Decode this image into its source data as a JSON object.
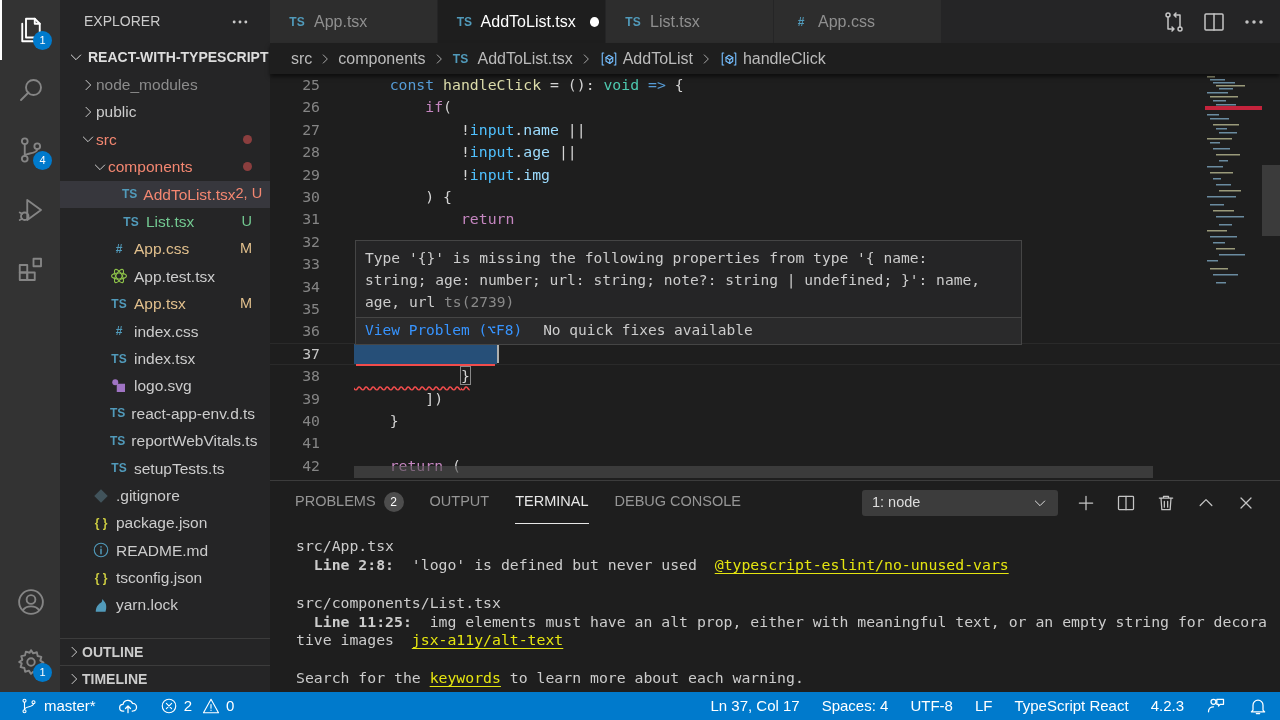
{
  "activity_bar": [
    {
      "kind": "files",
      "selected": true,
      "badge": "1"
    },
    {
      "kind": "search",
      "selected": false
    },
    {
      "kind": "source-control",
      "selected": false,
      "badge": "4"
    },
    {
      "kind": "run",
      "selected": false
    },
    {
      "kind": "extensions",
      "selected": false
    },
    {
      "kind": "account",
      "selected": false
    },
    {
      "kind": "settings",
      "selected": false,
      "badge": "1"
    }
  ],
  "sidebar": {
    "title": "EXPLORER",
    "root": {
      "label": "REACT-WITH-TYPESCRIPT",
      "expanded": true
    },
    "items": [
      {
        "name": "node_modules",
        "kind": "folder",
        "expanded": false,
        "color": "#8c8c8c"
      },
      {
        "name": "public",
        "kind": "folder",
        "expanded": false,
        "color": "#cccccc"
      },
      {
        "name": "src",
        "kind": "folder",
        "expanded": true,
        "color": "#f48771",
        "dot": true,
        "children": [
          {
            "name": "components",
            "kind": "folder",
            "expanded": true,
            "color": "#f48771",
            "dot": true,
            "children": [
              {
                "name": "AddToList.tsx",
                "kind": "ts-file",
                "glyph": "TS",
                "color": "#f48771",
                "badge": "2, U",
                "selected": true
              },
              {
                "name": "List.tsx",
                "kind": "ts-file",
                "glyph": "TS",
                "color": "#73c991",
                "badge": "U",
                "selected": false
              }
            ]
          },
          {
            "name": "App.css",
            "kind": "css-file",
            "glyph": "#",
            "color": "#e2c08d",
            "badge": "M",
            "selected": false
          },
          {
            "name": "App.test.tsx",
            "kind": "react-file",
            "color": "#cccccc",
            "selected": false
          },
          {
            "name": "App.tsx",
            "kind": "ts-file",
            "glyph": "TS",
            "color": "#e2c08d",
            "badge": "M",
            "selected": false
          },
          {
            "name": "index.css",
            "kind": "css-file",
            "glyph": "#",
            "color": "#cccccc",
            "selected": false
          },
          {
            "name": "index.tsx",
            "kind": "ts-file",
            "glyph": "TS",
            "color": "#cccccc",
            "selected": false
          },
          {
            "name": "logo.svg",
            "kind": "svg-file",
            "color": "#cccccc",
            "selected": false
          },
          {
            "name": "react-app-env.d.ts",
            "kind": "ts-file",
            "glyph": "TS",
            "color": "#cccccc",
            "selected": false
          },
          {
            "name": "reportWebVitals.ts",
            "kind": "ts-file",
            "glyph": "TS",
            "color": "#cccccc",
            "selected": false
          },
          {
            "name": "setupTests.ts",
            "kind": "ts-file",
            "glyph": "TS",
            "color": "#cccccc",
            "selected": false
          }
        ]
      },
      {
        "name": ".gitignore",
        "kind": "git-file",
        "color": "#cccccc",
        "selected": false
      },
      {
        "name": "package.json",
        "kind": "json-file",
        "glyph": "{ }",
        "color": "#cccccc",
        "selected": false
      },
      {
        "name": "README.md",
        "kind": "info-file",
        "color": "#cccccc",
        "selected": false
      },
      {
        "name": "tsconfig.json",
        "kind": "json-file",
        "glyph": "{ }",
        "color": "#cccccc",
        "selected": false
      },
      {
        "name": "yarn.lock",
        "kind": "yarn-file",
        "color": "#cccccc",
        "selected": false
      }
    ],
    "sections": [
      {
        "label": "OUTLINE",
        "expanded": false
      },
      {
        "label": "TIMELINE",
        "expanded": false
      }
    ]
  },
  "tabs": [
    {
      "label": "App.tsx",
      "glyph": "TS",
      "selected": false,
      "dirty": false
    },
    {
      "label": "AddToList.tsx",
      "glyph": "TS",
      "selected": true,
      "dirty": true
    },
    {
      "label": "List.tsx",
      "glyph": "TS",
      "selected": false,
      "dirty": false
    },
    {
      "label": "App.css",
      "glyph": "#",
      "selected": false,
      "dirty": false
    }
  ],
  "breadcrumbs": [
    {
      "label": "src",
      "kind": "folder"
    },
    {
      "label": "components",
      "kind": "folder"
    },
    {
      "label": "AddToList.tsx",
      "kind": "file",
      "glyph": "TS"
    },
    {
      "label": "AddToList",
      "kind": "symbol"
    },
    {
      "label": "handleClick",
      "kind": "symbol"
    }
  ],
  "code_lines": [
    {
      "number": "25",
      "tokens": [
        {
          "kind": "keyword",
          "text": "    const "
        },
        {
          "kind": "fn",
          "text": "handleClick"
        },
        {
          "kind": "plain",
          "text": " = (): "
        },
        {
          "kind": "type",
          "text": "void"
        },
        {
          "kind": "keyword",
          "text": " =>"
        },
        {
          "kind": "plain",
          "text": " {"
        }
      ]
    },
    {
      "number": "26",
      "tokens": [
        {
          "kind": "control",
          "text": "        if"
        },
        {
          "kind": "plain",
          "text": "("
        }
      ]
    },
    {
      "number": "27",
      "tokens": [
        {
          "kind": "plain",
          "text": "            !"
        },
        {
          "kind": "var",
          "text": "input"
        },
        {
          "kind": "plain",
          "text": "."
        },
        {
          "kind": "prop",
          "text": "name"
        },
        {
          "kind": "plain",
          "text": " ||"
        }
      ]
    },
    {
      "number": "28",
      "tokens": [
        {
          "kind": "plain",
          "text": "            !"
        },
        {
          "kind": "var",
          "text": "input"
        },
        {
          "kind": "plain",
          "text": "."
        },
        {
          "kind": "prop",
          "text": "age"
        },
        {
          "kind": "plain",
          "text": " ||"
        }
      ]
    },
    {
      "number": "29",
      "tokens": [
        {
          "kind": "plain",
          "text": "            !"
        },
        {
          "kind": "var",
          "text": "input"
        },
        {
          "kind": "plain",
          "text": "."
        },
        {
          "kind": "prop",
          "text": "img"
        }
      ]
    },
    {
      "number": "30",
      "tokens": [
        {
          "kind": "plain",
          "text": "        ) {"
        }
      ]
    },
    {
      "number": "31",
      "tokens": [
        {
          "kind": "control",
          "text": "            return"
        }
      ]
    },
    {
      "number": "32"
    },
    {
      "number": "33"
    },
    {
      "number": "34"
    },
    {
      "number": "35"
    },
    {
      "number": "36"
    },
    {
      "number": "37",
      "current": true,
      "error": true
    },
    {
      "number": "38",
      "current": false,
      "error": true,
      "tokens": [
        {
          "kind": "bracket",
          "text": "            }"
        }
      ]
    },
    {
      "number": "39",
      "tokens": [
        {
          "kind": "plain",
          "text": "        ])"
        }
      ]
    },
    {
      "number": "40",
      "tokens": [
        {
          "kind": "plain",
          "text": "    }"
        }
      ]
    },
    {
      "number": "41"
    },
    {
      "number": "42",
      "tokens": [
        {
          "kind": "control",
          "text": "    return"
        },
        {
          "kind": "plain",
          "text": " ("
        }
      ]
    }
  ],
  "hover": {
    "message": [
      "Type '{}' is missing the following properties from type '{ name:",
      "string; age: number; url: string; note?: string | undefined; }': name,",
      "age, url"
    ],
    "code": "ts(2739)",
    "action": "View Problem (⌥F8)",
    "note": "No quick fixes available"
  },
  "panel": {
    "tabs": [
      {
        "label": "PROBLEMS",
        "count": "2",
        "selected": false
      },
      {
        "label": "OUTPUT",
        "selected": false
      },
      {
        "label": "TERMINAL",
        "selected": true
      },
      {
        "label": "DEBUG CONSOLE",
        "selected": false
      }
    ],
    "terminal_select": "1: node",
    "lines": [
      {
        "kind": "text",
        "segments": [
          {
            "kind": "plain",
            "text": "src/App.tsx"
          }
        ]
      },
      {
        "kind": "text",
        "segments": [
          {
            "kind": "bold",
            "text": "  Line 2:8:"
          },
          {
            "kind": "plain",
            "text": "  'logo' is defined but never used  "
          },
          {
            "kind": "link",
            "text": "@typescript-eslint/no-unused-vars"
          }
        ]
      },
      {
        "kind": "blank"
      },
      {
        "kind": "text",
        "segments": [
          {
            "kind": "plain",
            "text": "src/components/List.tsx"
          }
        ]
      },
      {
        "kind": "text",
        "segments": [
          {
            "kind": "bold",
            "text": "  Line 11:25:"
          },
          {
            "kind": "plain",
            "text": "  img elements must have an alt prop, either with meaningful text, or an empty string for decora"
          }
        ]
      },
      {
        "kind": "text",
        "segments": [
          {
            "kind": "plain",
            "text": "tive images  "
          },
          {
            "kind": "link",
            "text": "jsx-a11y/alt-text"
          }
        ]
      },
      {
        "kind": "blank"
      },
      {
        "kind": "text",
        "segments": [
          {
            "kind": "plain",
            "text": "Search for the "
          },
          {
            "kind": "link",
            "text": "keywords"
          },
          {
            "kind": "plain",
            "text": " to learn more about each warning."
          }
        ]
      }
    ]
  },
  "status_bar": [
    {
      "kind": "branch",
      "text": "master*"
    },
    {
      "kind": "sync"
    },
    {
      "kind": "problems",
      "errors": "2",
      "warnings": "0"
    },
    {
      "kind": "text",
      "text": "Ln 37, Col 17"
    },
    {
      "kind": "text",
      "text": "Spaces: 4"
    },
    {
      "kind": "text",
      "text": "UTF-8"
    },
    {
      "kind": "text",
      "text": "LF"
    },
    {
      "kind": "text",
      "text": "TypeScript React"
    },
    {
      "kind": "text",
      "text": "4.2.3"
    },
    {
      "kind": "feedback"
    },
    {
      "kind": "bell"
    }
  ]
}
